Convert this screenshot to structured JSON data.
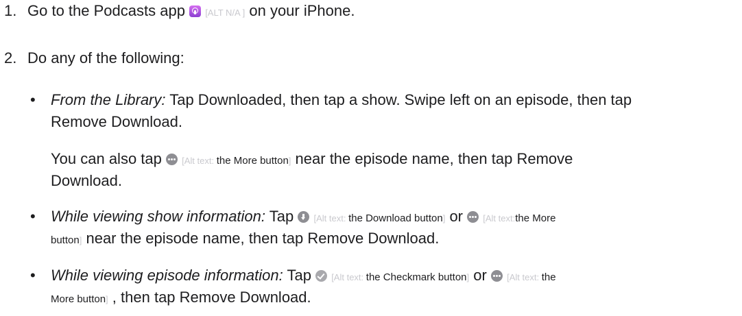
{
  "steps": {
    "one_num": "1.",
    "one_a": "Go to the Podcasts app",
    "one_alt": "[ALT N/A ]",
    "one_b": "on your iPhone.",
    "two_num": "2.",
    "two_text": "Do any of the following:"
  },
  "alt": {
    "prefix": "[Alt text:",
    "close": "]",
    "more_button": "the More button",
    "more_word": "the More",
    "button_word": "button",
    "download_button": "the Download button",
    "checkmark_button": "the Checkmark button",
    "the_word": "the",
    "more_button2": "More button"
  },
  "bullets": {
    "b1_label": "From the Library:",
    "b1_text_1": "Tap Downloaded, then tap a show. Swipe left on an episode, then tap",
    "b1_text_2": "Remove Download.",
    "b1_para_a": "You can also tap",
    "b1_para_b": "near the episode name, then tap Remove",
    "b1_para_c": "Download.",
    "b2_label": "While viewing show information:",
    "b2_tap": "Tap",
    "or": "or",
    "b2_text_2": "near the episode name, then tap Remove Download.",
    "b3_label": "While viewing episode information:",
    "b3_tap": "Tap",
    "b3_text_2": ", then tap Remove Download.",
    "bullet_char": "•"
  },
  "icons": {
    "podcasts": "podcasts-app-icon",
    "more": "more-icon",
    "download": "download-icon",
    "checkmark": "checkmark-icon"
  },
  "colors": {
    "podcasts_gradient": [
      "#d56ef0",
      "#8b3fd1"
    ],
    "icon_gray": "#8e8e93",
    "alt_gray": "#c9c9ce"
  }
}
